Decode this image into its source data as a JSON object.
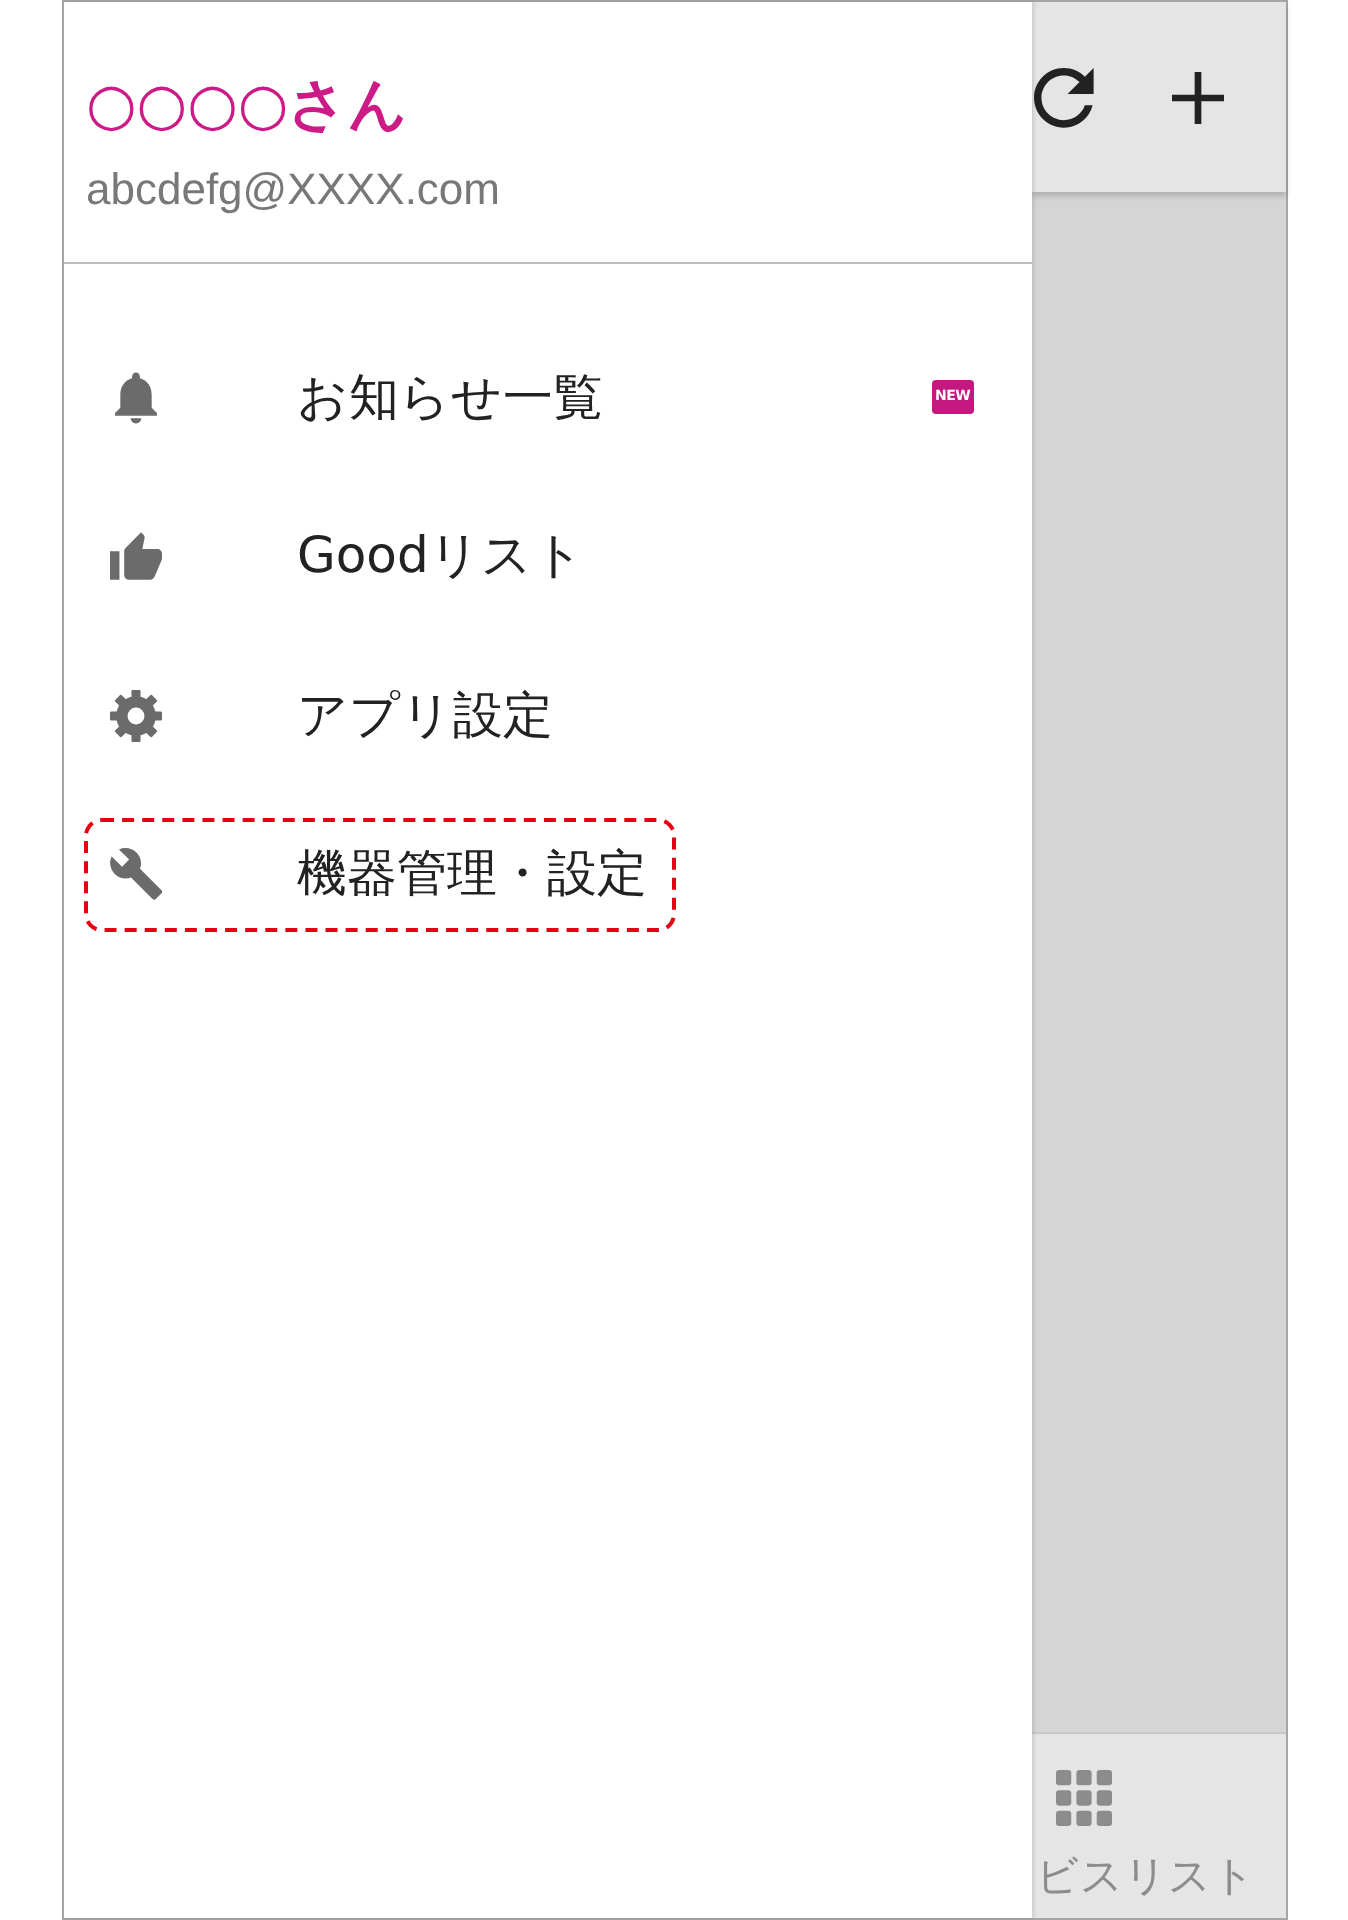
{
  "drawer": {
    "user": {
      "name": "○○○○さん",
      "email": "abcdefg@XXXX.com"
    },
    "items": [
      {
        "label": "お知らせ一覧",
        "kind": "notices",
        "badge": "NEW",
        "highlighted": false
      },
      {
        "label": "Goodリスト",
        "kind": "likes",
        "highlighted": false
      },
      {
        "label": "アプリ設定",
        "kind": "settings",
        "highlighted": false
      },
      {
        "label": "機器管理・設定",
        "kind": "devices",
        "highlighted": true
      }
    ]
  },
  "bottom_nav": {
    "items": [
      {
        "label": "ビスリスト"
      }
    ]
  }
}
